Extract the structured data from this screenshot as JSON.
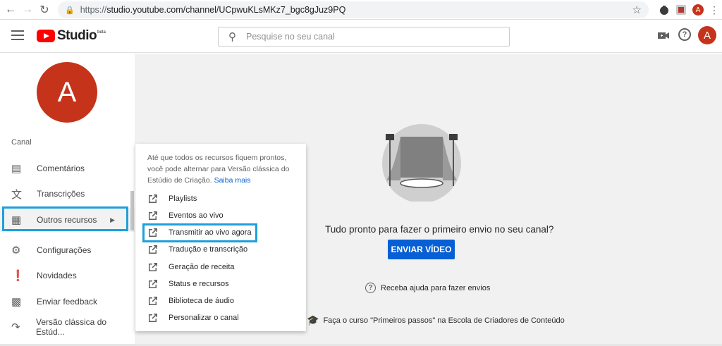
{
  "browser": {
    "url_scheme": "https://",
    "url_rest": "studio.youtube.com/channel/UCpwuKLsMKz7_bgc8gJuz9PQ",
    "profile_initial": "A"
  },
  "header": {
    "logo_text": "Studio",
    "beta_label": "beta",
    "search_placeholder": "Pesquise no seu canal",
    "avatar_initial": "A"
  },
  "sidebar": {
    "avatar_initial": "A",
    "section_title": "Canal",
    "items": [
      {
        "label": "Comentários",
        "icon": "comment-icon"
      },
      {
        "label": "Transcrições",
        "icon": "translate-icon"
      },
      {
        "label": "Outros recursos",
        "icon": "more-features-icon"
      },
      {
        "label": "Configurações",
        "icon": "gear-icon"
      },
      {
        "label": "Novidades",
        "icon": "alert-icon"
      },
      {
        "label": "Enviar feedback",
        "icon": "feedback-icon"
      },
      {
        "label": "Versão clássica do Estúd...",
        "icon": "classic-studio-icon"
      }
    ]
  },
  "popup": {
    "intro": "Até que todos os recursos fiquem prontos, você pode alternar para Versão clássica do Estúdio de Criação.",
    "learn_more": "Saiba mais",
    "items": [
      "Playlists",
      "Eventos ao vivo",
      "Transmitir ao vivo agora",
      "Tradução e transcrição",
      "Geração de receita",
      "Status e recursos",
      "Biblioteca de áudio",
      "Personalizar o canal"
    ]
  },
  "main": {
    "message": "Tudo pronto para fazer o primeiro envio no seu canal?",
    "upload_button": "ENVIAR VÍDEO",
    "help_link": "Receba ajuda para fazer envios",
    "course_link": "Faça o curso \"Primeiros passos\" na Escola de Criadores de Conteúdo"
  },
  "colors": {
    "accent_blue": "#065fd4",
    "highlight_box": "#1ea0db",
    "avatar_red": "#c5331b",
    "youtube_red": "#ff0000"
  }
}
